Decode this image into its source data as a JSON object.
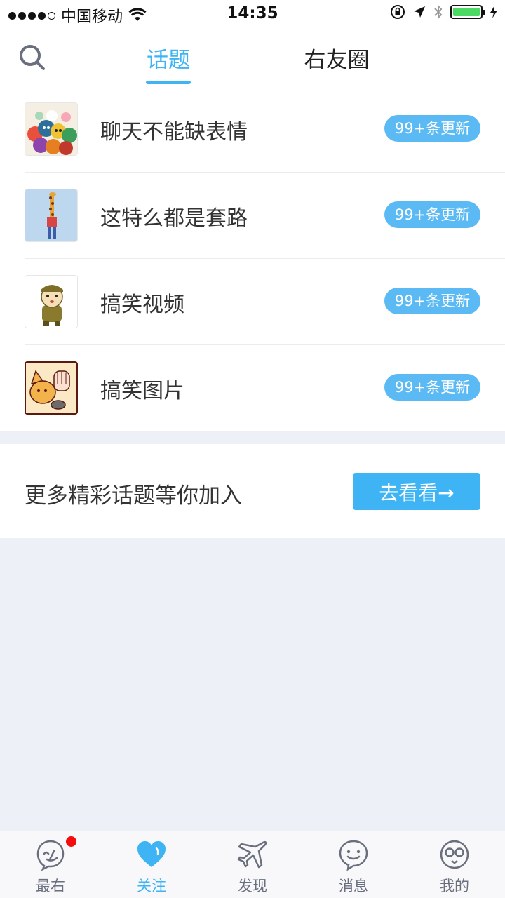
{
  "status_bar": {
    "carrier": "中国移动",
    "time": "14:35"
  },
  "header": {
    "tabs": [
      {
        "label": "话题",
        "active": true
      },
      {
        "label": "右友圈",
        "active": false
      }
    ]
  },
  "topics": [
    {
      "title": "聊天不能缺表情",
      "badge": "99+条更新",
      "thumb": "cartoon-crowd-thumbnail"
    },
    {
      "title": "这特么都是套路",
      "badge": "99+条更新",
      "thumb": "giraffe-thumbnail"
    },
    {
      "title": "搞笑视频",
      "badge": "99+条更新",
      "thumb": "soldier-cartoon-thumbnail"
    },
    {
      "title": "搞笑图片",
      "badge": "99+条更新",
      "thumb": "cat-cartoon-thumbnail"
    }
  ],
  "more": {
    "text": "更多精彩话题等你加入",
    "button_label": "去看看→"
  },
  "tabbar": {
    "items": [
      {
        "label": "最右",
        "icon": "face-icon",
        "active": false,
        "notification_dot": true
      },
      {
        "label": "关注",
        "icon": "heart-icon",
        "active": true
      },
      {
        "label": "发现",
        "icon": "plane-icon",
        "active": false
      },
      {
        "label": "消息",
        "icon": "chat-bubble-icon",
        "active": false
      },
      {
        "label": "我的",
        "icon": "glasses-face-icon",
        "active": false
      }
    ]
  },
  "colors": {
    "accent": "#3eb4f4",
    "badge": "#5bbaf3",
    "background": "#eef0f8",
    "notification": "#f50d0d"
  }
}
